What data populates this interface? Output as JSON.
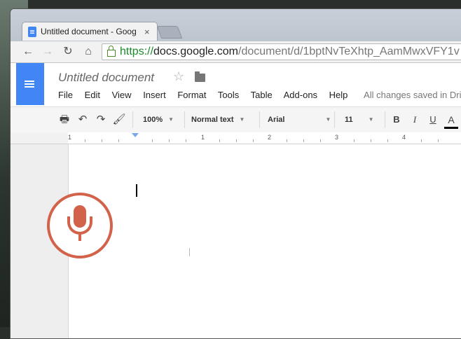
{
  "browser": {
    "tab_title": "Untitled document - Goog",
    "tab_close": "×",
    "url_https": "https://",
    "url_host": "docs.google.com",
    "url_path": "/document/d/1bptNvTeXhtp_AamMwxVFY1v"
  },
  "nav": {
    "back_icon": "←",
    "forward_icon": "→",
    "reload_icon": "↻",
    "home_icon": "⌂"
  },
  "docs": {
    "title": "Untitled document",
    "star_icon": "☆",
    "menu": [
      "File",
      "Edit",
      "View",
      "Insert",
      "Format",
      "Tools",
      "Table",
      "Add-ons",
      "Help"
    ],
    "save_status": "All changes saved in Dri"
  },
  "toolbar": {
    "print_icon": "🖶",
    "undo_icon": "↶",
    "redo_icon": "↷",
    "paint_format_icon": "🖌",
    "zoom": "100%",
    "style": "Normal text",
    "font": "Arial",
    "size": "11",
    "bold": "B",
    "italic": "I",
    "underline": "U",
    "text_color": "A",
    "caret": "▼"
  },
  "ruler": [
    "1",
    "1",
    "2",
    "3",
    "4"
  ],
  "colors": {
    "docs_blue": "#4285f4",
    "mic_red": "#d3624a",
    "secure_green": "#1a8a2a"
  }
}
